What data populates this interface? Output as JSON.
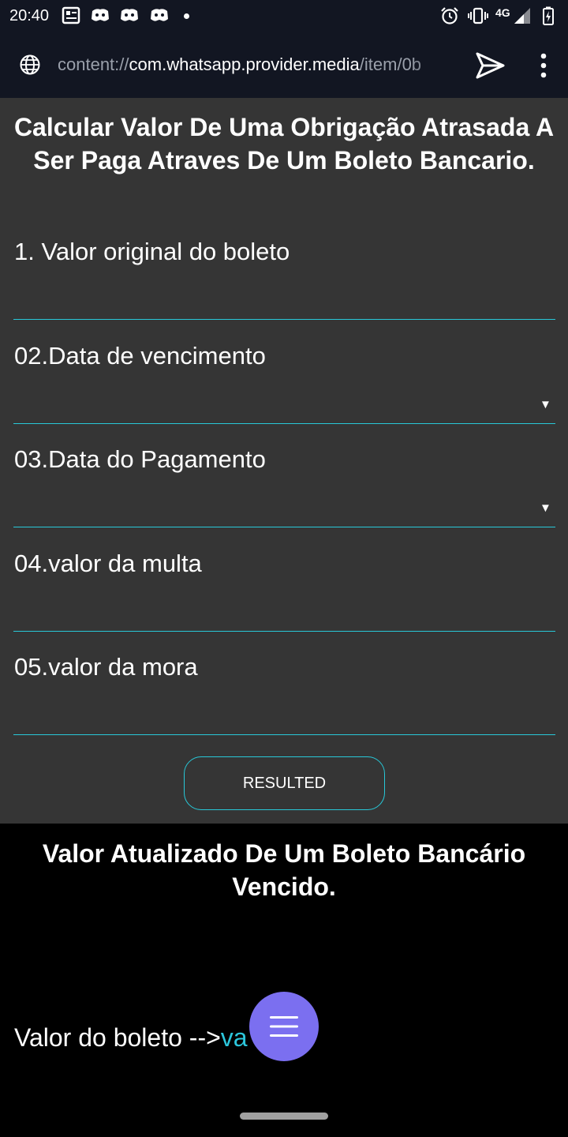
{
  "status_bar": {
    "time": "20:40",
    "network": "4G",
    "icons": [
      "newspaper-icon",
      "discord-icon",
      "discord-icon",
      "discord-icon",
      "dot-icon",
      "alarm-icon",
      "vibrate-icon",
      "signal-icon",
      "battery-charging-icon"
    ]
  },
  "browser": {
    "url_scheme": "content://",
    "url_host": "com.whatsapp.provider.media",
    "url_path": "/item/0b",
    "icons": [
      "globe-icon",
      "send-icon",
      "more-vert-icon"
    ]
  },
  "form": {
    "title": "Calcular Valor De Uma Obrigação Atrasada A Ser Paga Atraves De Um Boleto Bancario.",
    "fields": [
      {
        "label": "1. Valor original do boleto",
        "value": ""
      },
      {
        "label": "02.Data de vencimento",
        "value": ""
      },
      {
        "label": "03.Data do Pagamento",
        "value": ""
      },
      {
        "label": "04.valor da multa",
        "value": ""
      },
      {
        "label": "05.valor da mora",
        "value": ""
      }
    ],
    "dropdown_arrow": "▼",
    "button_label": "RESULTED"
  },
  "result": {
    "title": "Valor Atualizado De Um Boleto Bancário Vencido.",
    "label": "Valor do boleto -->",
    "value": "va"
  },
  "colors": {
    "panel": "#353535",
    "accent": "#28c8d8",
    "fab": "#7b6ff0",
    "chrome": "#121622"
  }
}
